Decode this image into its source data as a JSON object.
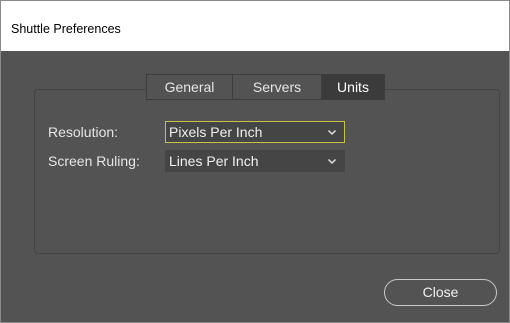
{
  "window": {
    "title": "Shuttle Preferences"
  },
  "tabs": [
    {
      "label": "General",
      "active": false
    },
    {
      "label": "Servers",
      "active": false
    },
    {
      "label": "Units",
      "active": true
    }
  ],
  "units": {
    "resolution_label": "Resolution:",
    "resolution_value": "Pixels Per Inch",
    "screen_ruling_label": "Screen Ruling:",
    "screen_ruling_value": "Lines Per Inch"
  },
  "footer": {
    "close_label": "Close"
  },
  "colors": {
    "dialog_background": "#535353",
    "field_background": "#454545",
    "active_tab_background": "#3b3b3b",
    "focus_border": "#c9c24a",
    "text": "#e6e6e6"
  },
  "icons": {
    "dropdown": "chevron-down-icon"
  }
}
